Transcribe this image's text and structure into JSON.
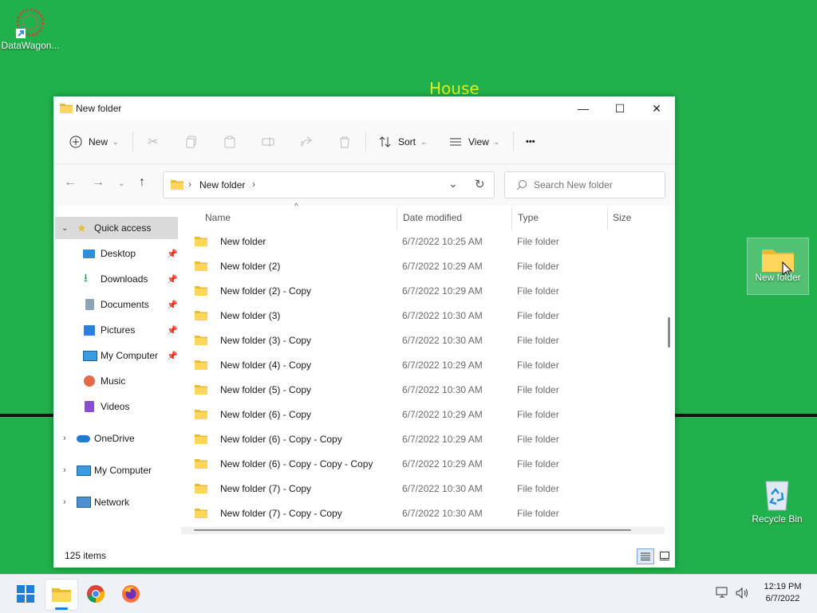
{
  "desktop": {
    "background_color": "#21b14c",
    "overlay_text": "House",
    "icons": [
      {
        "label": "DataWagon...",
        "icon": "datawagon-shortcut-icon"
      },
      {
        "label": "New folder",
        "icon": "folder-icon"
      },
      {
        "label": "Recycle Bin",
        "icon": "recycle-bin-icon"
      }
    ]
  },
  "window": {
    "title": "New folder",
    "controls": {
      "minimize": "—",
      "maximize": "☐",
      "close": "✕"
    },
    "toolbar": {
      "new_label": "New",
      "sort_label": "Sort",
      "view_label": "View",
      "more_label": "•••"
    },
    "address": {
      "path": [
        "New folder"
      ],
      "search_placeholder": "Search New folder"
    },
    "sidebar": {
      "quick_access": "Quick access",
      "quick_items": [
        {
          "label": "Desktop",
          "icon": "desktop-icon",
          "pinned": true
        },
        {
          "label": "Downloads",
          "icon": "download-icon",
          "pinned": true
        },
        {
          "label": "Documents",
          "icon": "documents-icon",
          "pinned": true
        },
        {
          "label": "Pictures",
          "icon": "pictures-icon",
          "pinned": true
        },
        {
          "label": "My Computer",
          "icon": "computer-icon",
          "pinned": true
        },
        {
          "label": "Music",
          "icon": "music-icon",
          "pinned": false
        },
        {
          "label": "Videos",
          "icon": "videos-icon",
          "pinned": false
        }
      ],
      "roots": [
        {
          "label": "OneDrive",
          "icon": "onedrive-icon"
        },
        {
          "label": "My Computer",
          "icon": "computer-icon"
        },
        {
          "label": "Network",
          "icon": "network-icon"
        }
      ]
    },
    "columns": {
      "name": "Name",
      "date": "Date modified",
      "type": "Type",
      "size": "Size"
    },
    "files": [
      {
        "name": "New folder",
        "date": "6/7/2022 10:25 AM",
        "type": "File folder"
      },
      {
        "name": "New folder (2)",
        "date": "6/7/2022 10:29 AM",
        "type": "File folder"
      },
      {
        "name": "New folder (2) - Copy",
        "date": "6/7/2022 10:29 AM",
        "type": "File folder"
      },
      {
        "name": "New folder (3)",
        "date": "6/7/2022 10:30 AM",
        "type": "File folder"
      },
      {
        "name": "New folder (3) - Copy",
        "date": "6/7/2022 10:30 AM",
        "type": "File folder"
      },
      {
        "name": "New folder (4) - Copy",
        "date": "6/7/2022 10:29 AM",
        "type": "File folder"
      },
      {
        "name": "New folder (5) - Copy",
        "date": "6/7/2022 10:30 AM",
        "type": "File folder"
      },
      {
        "name": "New folder (6) - Copy",
        "date": "6/7/2022 10:29 AM",
        "type": "File folder"
      },
      {
        "name": "New folder (6) - Copy - Copy",
        "date": "6/7/2022 10:29 AM",
        "type": "File folder"
      },
      {
        "name": "New folder (6) - Copy - Copy - Copy",
        "date": "6/7/2022 10:29 AM",
        "type": "File folder"
      },
      {
        "name": "New folder (7) - Copy",
        "date": "6/7/2022 10:30 AM",
        "type": "File folder"
      },
      {
        "name": "New folder (7) - Copy - Copy",
        "date": "6/7/2022 10:30 AM",
        "type": "File folder"
      }
    ],
    "status": {
      "count": "125 items"
    }
  },
  "taskbar": {
    "apps": [
      "start-icon",
      "file-explorer-icon",
      "chrome-icon",
      "firefox-icon"
    ],
    "clock": {
      "time": "12:19 PM",
      "date": "6/7/2022"
    }
  }
}
